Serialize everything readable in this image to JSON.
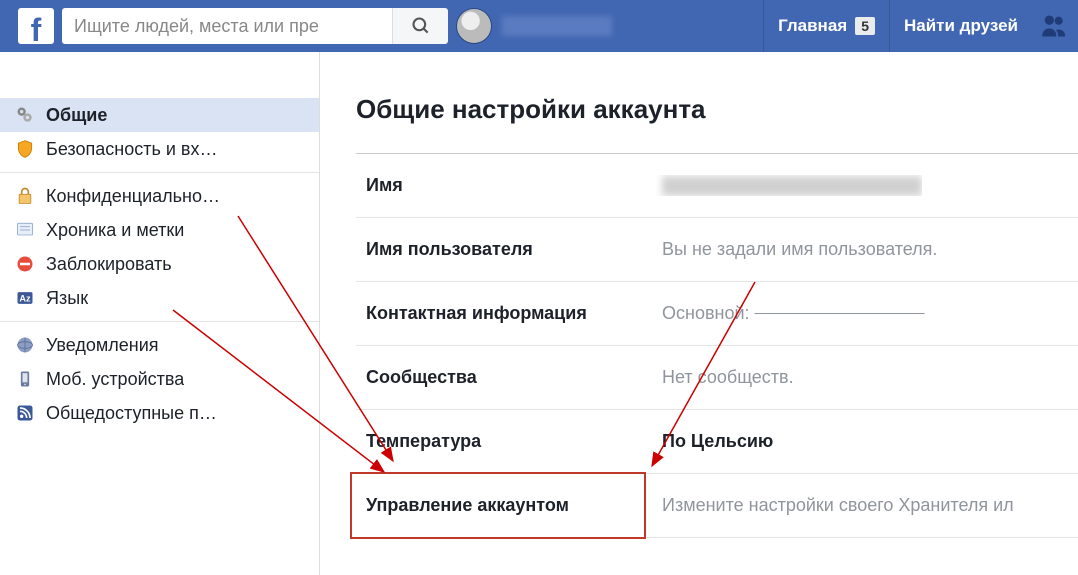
{
  "header": {
    "search_placeholder": "Ищите людей, места или пре",
    "home_label": "Главная",
    "home_badge": "5",
    "find_friends_label": "Найти друзей"
  },
  "sidebar": {
    "groups": [
      {
        "items": [
          {
            "key": "general",
            "label": "Общие",
            "active": true
          },
          {
            "key": "security",
            "label": "Безопасность и вх…"
          }
        ]
      },
      {
        "items": [
          {
            "key": "privacy",
            "label": "Конфиденциально…"
          },
          {
            "key": "timeline",
            "label": "Хроника и метки"
          },
          {
            "key": "blocking",
            "label": "Заблокировать"
          },
          {
            "key": "language",
            "label": "Язык"
          }
        ]
      },
      {
        "items": [
          {
            "key": "notifications",
            "label": "Уведомления"
          },
          {
            "key": "mobile",
            "label": "Моб. устройства"
          },
          {
            "key": "publicposts",
            "label": "Общедоступные п…"
          }
        ]
      }
    ]
  },
  "main": {
    "title": "Общие настройки аккаунта",
    "rows": {
      "name": {
        "label": "Имя"
      },
      "username": {
        "label": "Имя пользователя",
        "value": "Вы не задали имя пользователя."
      },
      "contact": {
        "label": "Контактная информация",
        "value_prefix": "Основной: "
      },
      "networks": {
        "label": "Сообщества",
        "value": "Нет сообществ."
      },
      "temperature": {
        "label": "Температура",
        "value": "По Цельсию"
      },
      "manage": {
        "label": "Управление аккаунтом",
        "value": "Измените настройки своего Хранителя ил"
      }
    }
  }
}
